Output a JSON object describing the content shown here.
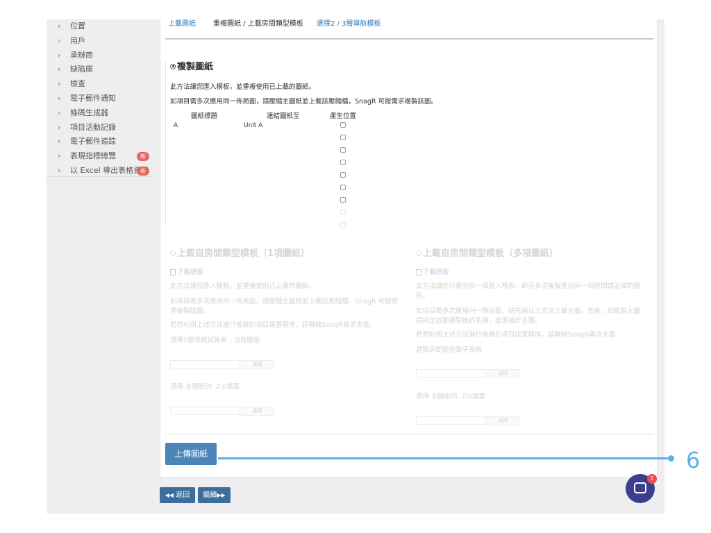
{
  "sidebar": {
    "items": [
      {
        "label": "位置",
        "badge": ""
      },
      {
        "label": "用戶",
        "badge": ""
      },
      {
        "label": "承辦商",
        "badge": ""
      },
      {
        "label": "缺陷庫",
        "badge": ""
      },
      {
        "label": "檢查",
        "badge": ""
      },
      {
        "label": "電子郵件通知",
        "badge": ""
      },
      {
        "label": "條碼生成器",
        "badge": ""
      },
      {
        "label": "項目活動記錄",
        "badge": ""
      },
      {
        "label": "電子郵件追踪",
        "badge": ""
      },
      {
        "label": "表現指標總覽",
        "badge": "新"
      },
      {
        "label": "以 Excel 導出表格資料",
        "badge": "新"
      }
    ]
  },
  "tabs": [
    {
      "label": "上載圖紙"
    },
    {
      "label": "重複圖紙 / 上載房間類型模板"
    },
    {
      "label": "選擇2 / 3層導航模板"
    }
  ],
  "copy": {
    "heading": "複製圖紙",
    "desc1": "此方法讓您匯入模板，並重複使用已上載的圖紙。",
    "desc2": "如項目需多次應用同一佈局圖，請壓縮主圖紙並上載該壓縮檔，SnagR 可按需求複製該圖。",
    "columns": {
      "title": "圖紙標題",
      "link": "連結圖紙至",
      "generate": "產生位置"
    },
    "rows": [
      {
        "title": "A",
        "link": "Unit A"
      }
    ]
  },
  "room_single": {
    "heading": "上載自房間類型模板（1項圖紙）",
    "download": "下載模板",
    "desc1": "此方法讓您匯入模板，並重複使用已上載的圖紙。",
    "desc2": "如項目需多次應用同一佈局圖，請壓縮主圖紙並上載該壓縮檔，SnagR 可按需求複製該圖。",
    "desc3": "若想利用上述方法進行複雜的項目設置程序，請聯絡SnagR尋求支援。",
    "select_sheet": "選擇2層導航試算表 - 沒有圖紙",
    "choose_btn": "選擇",
    "select_zip": "選擇 主圖紙的 .Zip檔案",
    "choose_btn2": "選擇"
  },
  "room_multi": {
    "heading": "上載自房間類型模板（多項圖紙）",
    "download": "下載模板",
    "desc1": "此方法讓您只需利用一個匯入模板，即可多次複製使用同一個房間或區域的圖則。",
    "desc2": "如項目需多次應用同一佈局圖，請先用以上方法上載主圖。其後，如複製主圖，請指定該圖複製後的名稱，並連接於主圖。",
    "desc3": "若想利用上述方法進行複雜的項目設置程序，請聯絡SnagR尋求支援。",
    "select_sheet": "選取房間類型電子表格",
    "choose_btn": "選擇",
    "select_zip": "選擇 主圖紙的 .Zip檔案",
    "choose_btn2": "選擇"
  },
  "upload_button": "上傳圖紙",
  "callout_number": "6",
  "nav": {
    "back": "返回",
    "continue": "繼續"
  },
  "chat_badge": "1"
}
